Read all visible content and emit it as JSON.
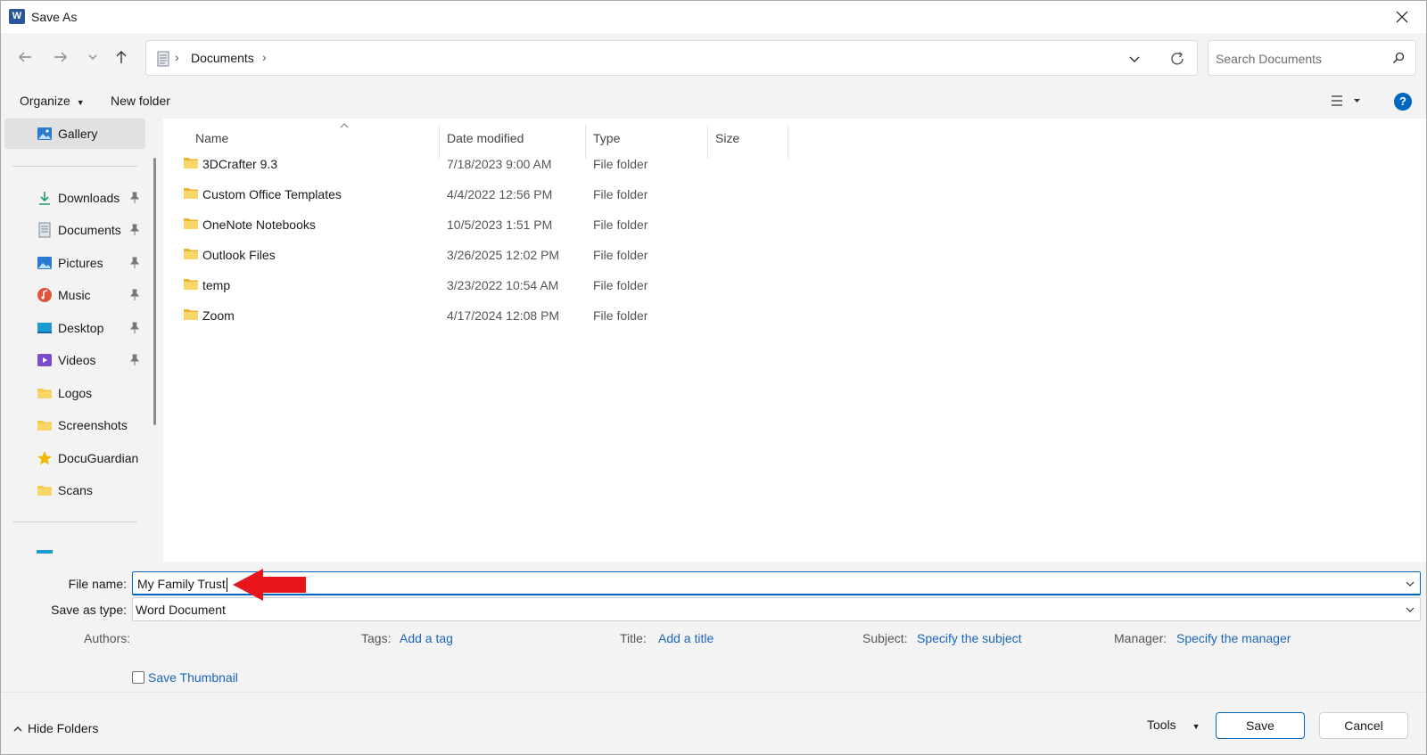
{
  "window": {
    "title": "Save As",
    "app_icon_letter": "W"
  },
  "nav": {
    "breadcrumb": [
      "Documents"
    ],
    "search_placeholder": "Search Documents"
  },
  "toolbar": {
    "organize_label": "Organize",
    "new_folder_label": "New folder",
    "help_label": "?"
  },
  "sidebar": {
    "items": [
      {
        "label": "Gallery",
        "icon": "gallery-icon",
        "pinned": false,
        "selected": true
      },
      {
        "label": "Downloads",
        "icon": "download-icon",
        "pinned": true
      },
      {
        "label": "Documents",
        "icon": "document-icon",
        "pinned": true
      },
      {
        "label": "Pictures",
        "icon": "pictures-icon",
        "pinned": true
      },
      {
        "label": "Music",
        "icon": "music-icon",
        "pinned": true
      },
      {
        "label": "Desktop",
        "icon": "desktop-icon",
        "pinned": true
      },
      {
        "label": "Videos",
        "icon": "videos-icon",
        "pinned": true
      },
      {
        "label": "Logos",
        "icon": "folder-icon",
        "pinned": false
      },
      {
        "label": "Screenshots",
        "icon": "folder-icon",
        "pinned": false
      },
      {
        "label": "DocuGuardian",
        "icon": "star-icon",
        "pinned": false
      },
      {
        "label": "Scans",
        "icon": "folder-icon",
        "pinned": false
      }
    ]
  },
  "file_list": {
    "columns": [
      "Name",
      "Date modified",
      "Type",
      "Size"
    ],
    "rows": [
      {
        "name": "3DCrafter 9.3",
        "date": "7/18/2023 9:00 AM",
        "type": "File folder"
      },
      {
        "name": "Custom Office Templates",
        "date": "4/4/2022 12:56 PM",
        "type": "File folder"
      },
      {
        "name": "OneNote Notebooks",
        "date": "10/5/2023 1:51 PM",
        "type": "File folder"
      },
      {
        "name": "Outlook Files",
        "date": "3/26/2025 12:02 PM",
        "type": "File folder"
      },
      {
        "name": "temp",
        "date": "3/23/2022 10:54 AM",
        "type": "File folder"
      },
      {
        "name": "Zoom",
        "date": "4/17/2024 12:08 PM",
        "type": "File folder"
      }
    ]
  },
  "form": {
    "file_name_label": "File name:",
    "file_name_value": "My Family Trust",
    "save_type_label": "Save as type:",
    "save_type_value": "Word Document",
    "authors_label": "Authors:",
    "tags_label": "Tags:",
    "tags_link": "Add a tag",
    "title_label": "Title:",
    "title_link": "Add a title",
    "subject_label": "Subject:",
    "subject_link": "Specify the subject",
    "manager_label": "Manager:",
    "manager_link": "Specify the manager",
    "thumbnail_label": "Save Thumbnail",
    "thumbnail_checked": false
  },
  "footer": {
    "hide_folders_label": "Hide Folders",
    "tools_label": "Tools",
    "save_label": "Save",
    "cancel_label": "Cancel"
  },
  "colors": {
    "accent": "#0067c0",
    "link": "#1b66b8",
    "annotation_arrow": "#e8151b",
    "folder": "#f4c84a"
  }
}
